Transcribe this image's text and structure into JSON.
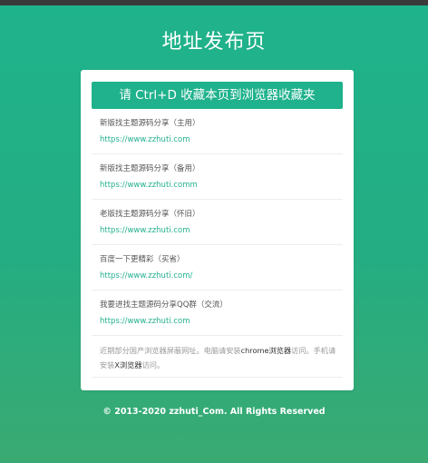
{
  "page": {
    "title": "地址发布页"
  },
  "banner": {
    "text": "请 Ctrl+D 收藏本页到浏览器收藏夹"
  },
  "links": [
    {
      "name": "新版找主题源码分享（主用）",
      "url": "https://www.zzhuti.com"
    },
    {
      "name": "新版找主题源码分享（备用）",
      "url": "https://www.zzhuti.comm"
    },
    {
      "name": "老版找主题源码分享（怀旧）",
      "url": "https://www.zzhuti.com"
    },
    {
      "name": "百度一下更精彩（买省）",
      "url": "https://www.zzhuti.com/"
    },
    {
      "name": "我要进找主题源码分享QQ群（交流）",
      "url": "https://www.zzhuti.com"
    }
  ],
  "notice": {
    "part1": "近期部分国产浏览器屏蔽网址。电脑请安装",
    "highlight1": "chrome浏览器",
    "part2": "访问。手机请安装",
    "highlight2": "X浏览器",
    "part3": "访问。"
  },
  "footer": {
    "copyright": "© 2013-2020 zzhuti_Com. All Rights Reserved"
  },
  "colors": {
    "brand_green": "#1fb28c",
    "link_green": "#24b08f",
    "top_bar": "#3a3a3a"
  }
}
